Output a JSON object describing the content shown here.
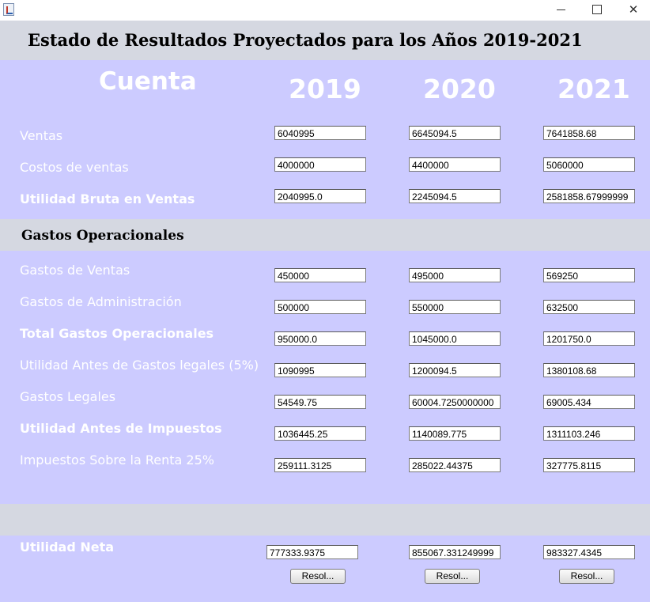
{
  "window": {
    "min_symbol": "—",
    "close_symbol": "✕"
  },
  "title": "Estado de Resultados Proyectados para los Años 2019-2021",
  "headers": {
    "account": "Cuenta",
    "years": [
      "2019",
      "2020",
      "2021"
    ]
  },
  "section_title": "Gastos Operacionales",
  "rows": [
    {
      "label": "Ventas",
      "values": [
        "6040995",
        "6645094.5",
        "7641858.68"
      ]
    },
    {
      "label": "Costos de ventas",
      "values": [
        "4000000",
        "4400000",
        "5060000"
      ]
    },
    {
      "label": "Utilidad Bruta en Ventas",
      "values": [
        "2040995.0",
        "2245094.5",
        "2581858.67999999"
      ]
    },
    {
      "label": "Gastos de Ventas",
      "values": [
        "450000",
        "495000",
        "569250"
      ]
    },
    {
      "label": "Gastos de Administración",
      "values": [
        "500000",
        "550000",
        "632500"
      ]
    },
    {
      "label": "Total Gastos Operacionales",
      "values": [
        "950000.0",
        "1045000.0",
        "1201750.0"
      ]
    },
    {
      "label": "Utilidad Antes de Gastos legales (5%)",
      "values": [
        "1090995",
        "1200094.5",
        "1380108.68"
      ]
    },
    {
      "label": "Gastos Legales",
      "values": [
        "54549.75",
        "60004.7250000000",
        "69005.434"
      ]
    },
    {
      "label": "Utilidad Antes de Impuestos",
      "values": [
        "1036445.25",
        "1140089.775",
        "1311103.246"
      ]
    },
    {
      "label": "Impuestos Sobre la Renta 25%",
      "values": [
        "259111.3125",
        "285022.44375",
        "327775.8115"
      ]
    }
  ],
  "net": {
    "label": "Utilidad Neta",
    "values": [
      "777333.9375",
      "855067.331249999",
      "983327.4345"
    ]
  },
  "buttons": [
    "Resol...",
    "Resol...",
    "Resol..."
  ],
  "colors": {
    "panel": "#cccbff",
    "band": "#d5d8e1",
    "label_text": "#ffffff"
  }
}
